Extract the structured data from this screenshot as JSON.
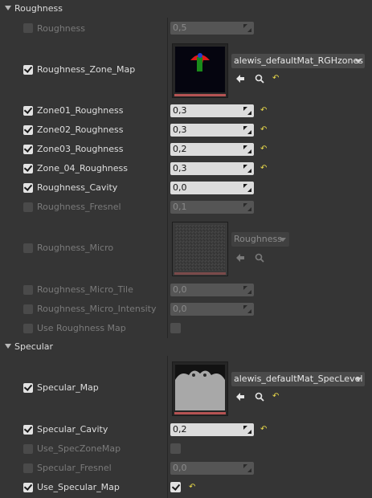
{
  "sections": {
    "roughness": "Roughness",
    "specular": "Specular"
  },
  "rows": {
    "roughness": {
      "label": "Roughness",
      "value": "0,5"
    },
    "roughness_zone_map": {
      "label": "Roughness_Zone_Map",
      "asset": "alewis_defaultMat_RGHzones"
    },
    "zone01": {
      "label": "Zone01_Roughness",
      "value": "0,3"
    },
    "zone02": {
      "label": "Zone02_Roughness",
      "value": "0,3"
    },
    "zone03": {
      "label": "Zone03_Roughness",
      "value": "0,2"
    },
    "zone04": {
      "label": "Zone_04_Roughness",
      "value": "0,3"
    },
    "roughness_cavity": {
      "label": "Roughness_Cavity",
      "value": "0,0"
    },
    "roughness_fresnel": {
      "label": "Roughness_Fresnel",
      "value": "0,1"
    },
    "roughness_micro": {
      "label": "Roughness_Micro",
      "asset": "Roughness"
    },
    "roughness_micro_tile": {
      "label": "Roughness_Micro_Tile",
      "value": "0,0"
    },
    "roughness_micro_intensity": {
      "label": "Roughness_Micro_Intensity",
      "value": "0,0"
    },
    "use_roughness_map": {
      "label": "Use Roughness Map"
    },
    "specular_map": {
      "label": "Specular_Map",
      "asset": "alewis_defaultMat_SpecLevel"
    },
    "specular_cavity": {
      "label": "Specular_Cavity",
      "value": "0,2"
    },
    "use_speczonemap": {
      "label": "Use_SpecZoneMap"
    },
    "specular_fresnel": {
      "label": "Specular_Fresnel",
      "value": "0,0"
    },
    "use_specular_map": {
      "label": "Use_Specular_Map"
    }
  },
  "icons": {
    "reset": "reset-to-default-icon",
    "use_selected": "arrow-left-icon",
    "browse": "search-icon"
  },
  "colors": {
    "accent_reset": "#e8d84a",
    "thumb_bar": "#b55353"
  }
}
